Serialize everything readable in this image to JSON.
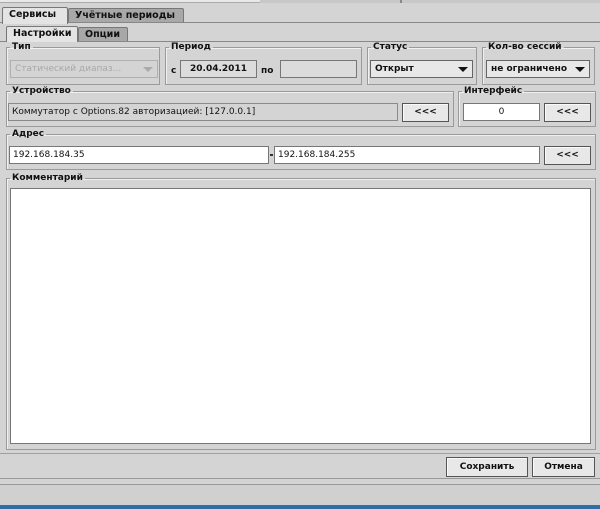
{
  "tabs": [
    {
      "label": "Сервисы",
      "active": true
    },
    {
      "label": "Учётные периоды",
      "active": false
    }
  ],
  "subtabs": [
    {
      "label": "Настройки",
      "active": true
    },
    {
      "label": "Опции",
      "active": false
    }
  ],
  "type_group": {
    "legend": "Тип",
    "value": "Статический диапаз..."
  },
  "period_group": {
    "legend": "Период",
    "from_label": "с",
    "from_value": "20.04.2011",
    "to_label": "по",
    "to_value": ""
  },
  "status_group": {
    "legend": "Статус",
    "value": "Открыт"
  },
  "sessions_group": {
    "legend": "Кол-во сессий",
    "value": "не ограничено"
  },
  "device_group": {
    "legend": "Устройство",
    "value": "Коммутатор с Options.82 авторизацией: [127.0.0.1]",
    "pick_label": "<<<"
  },
  "interface_group": {
    "legend": "Интерфейс",
    "value": "0",
    "pick_label": "<<<"
  },
  "address_group": {
    "legend": "Адрес",
    "from": "192.168.184.35",
    "to": "192.168.184.255",
    "pick_label": "<<<"
  },
  "comment_group": {
    "legend": "Комментарий",
    "value": ""
  },
  "actions": {
    "save_label": "Сохранить",
    "cancel_label": "Отмена"
  }
}
